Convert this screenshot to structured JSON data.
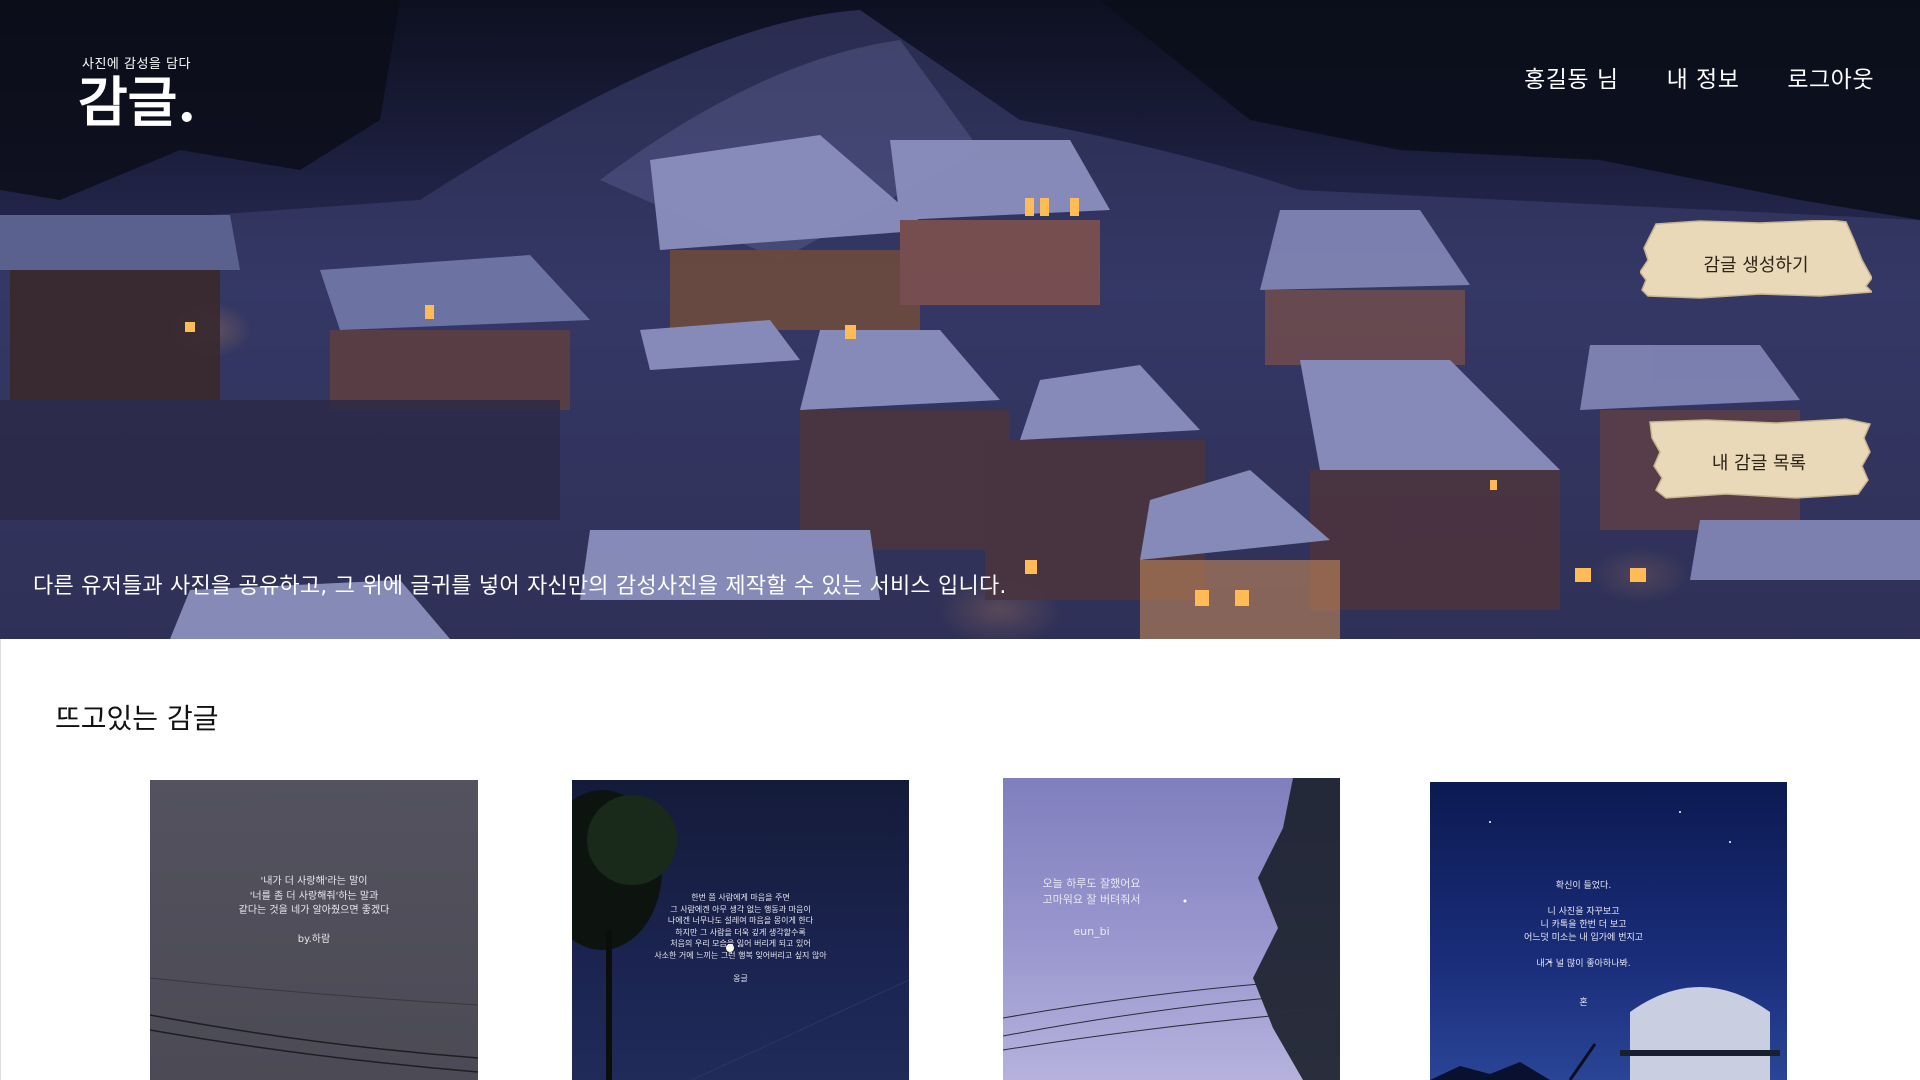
{
  "header": {
    "tagline": "사진에 감성을 담다",
    "logo": "감글",
    "logo_dot": ".",
    "nav": {
      "user": "홍길동 님",
      "profile": "내 정보",
      "logout": "로그아웃"
    }
  },
  "hero": {
    "create_button": "감글 생성하기",
    "list_button": "내 감글 목록",
    "description": "다른 유저들과 사진을 공유하고, 그 위에 글귀를 넣어 자신만의 감성사진을 제작할 수 있는 서비스 입니다."
  },
  "trending": {
    "title": "뜨고있는 감글",
    "cards": [
      {
        "lines": [
          "'내가 더 사랑해'라는 말이",
          "'너를 좀 더 사랑해줘'하는 말과",
          "같다는 것을 네가 알아줬으면 좋겠다",
          "",
          "by.하람"
        ]
      },
      {
        "lines": [
          "한번 쯤 사람에게 마음을 주면",
          "그 사람에겐 아무 생각 없는 행동과 마음이",
          "나에겐 너무나도 설레여 마음을 몽이게 한다",
          "하지만 그 사람을 더욱 깊게 생각할수록",
          "처음의 우리 모습을 잃어 버리게 되고 있어",
          "사소한 거에 느끼는 그런 행복 잊어버리고 싶지 않아",
          "",
          "옹글"
        ]
      },
      {
        "lines": [
          "오늘 하루도 잘했어요",
          "고마워요 잘 버텨줘서",
          "",
          "eun_bi"
        ]
      },
      {
        "lines": [
          "확신이 들었다.",
          "",
          "니 사진을 자꾸보고",
          "니 카톡을 한번 더 보고",
          "어느덧 미소는 내 입가에 번지고",
          "",
          "내가 널 많이 좋아하나봐.",
          "",
          "",
          "혼"
        ]
      }
    ]
  }
}
